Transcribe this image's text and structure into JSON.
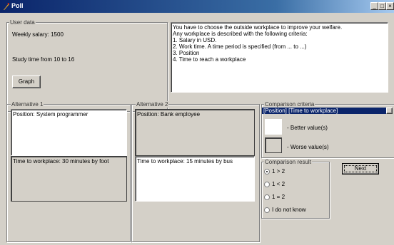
{
  "window": {
    "title": "Poll",
    "minimize": "_",
    "maximize": "□",
    "close": "×"
  },
  "user_data": {
    "legend": "User data",
    "salary": "Weekly salary: 1500",
    "study": "Study time from 10 to 16",
    "graph_button": "Graph"
  },
  "description": {
    "lines": [
      "You have to choose the outside workplace to improve your welfare.",
      "Any workplace is described with the following criteria:",
      "1. Salary in USD.",
      "2. Work time. A time period is specified (from ... to ...)",
      "3. Position",
      "4. Time to reach a workplace"
    ]
  },
  "alt1": {
    "legend": "Alternative 1",
    "position": "Position: System programmer",
    "time": "Time to workplace: 30 minutes by foot"
  },
  "alt2": {
    "legend": "Alternative 2",
    "position": "Position: Bank employee",
    "time": "Time to workplace: 15 minutes by bus"
  },
  "criteria": {
    "legend": "Comparison criteria",
    "selected": "[Position] [Time to workplace]",
    "better": "- Better value(s)",
    "worse": "- Worse value(s)"
  },
  "result": {
    "legend": "Comparison result",
    "options": [
      "1 > 2",
      "1 < 2",
      "1 = 2",
      "I do not know"
    ],
    "selected_index": 0
  },
  "next_button": "Next",
  "colors": {
    "title_start": "#0a246a",
    "title_end": "#a6caf0",
    "selection": "#0a246a",
    "face": "#d4d0c8"
  }
}
